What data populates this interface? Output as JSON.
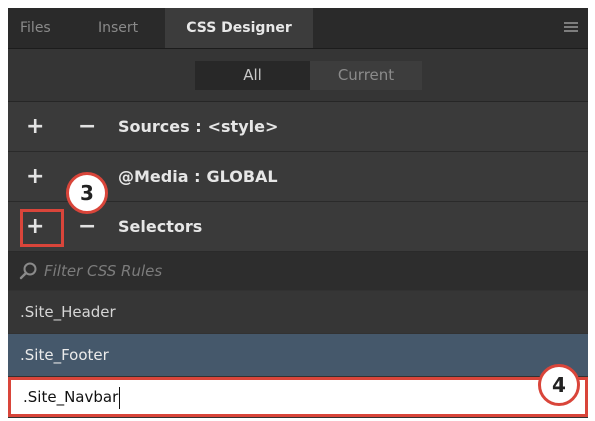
{
  "tabs": {
    "files": "Files",
    "insert": "Insert",
    "css_designer": "CSS Designer"
  },
  "toggle": {
    "all": "All",
    "current": "Current",
    "selected": "All"
  },
  "sections": {
    "sources": {
      "add": "+",
      "remove": "−",
      "label": "Sources :",
      "value": "<style>"
    },
    "media": {
      "add": "+",
      "remove": "−",
      "label": "@Media :",
      "value": "GLOBAL"
    },
    "selectors": {
      "add": "+",
      "remove": "−",
      "label": "Selectors"
    }
  },
  "filter": {
    "placeholder": "Filter CSS Rules",
    "icon": "search-icon"
  },
  "selector_list": [
    {
      "label": ".Site_Header",
      "state": "normal"
    },
    {
      "label": ".Site_Footer",
      "state": "selected"
    },
    {
      "label": ".Site_Navbar",
      "state": "editing"
    }
  ],
  "callouts": {
    "step3": "3",
    "step4": "4"
  },
  "colors": {
    "panel_bg": "#323232",
    "selected_row": "#45586b",
    "callout_red": "#d9453a"
  }
}
